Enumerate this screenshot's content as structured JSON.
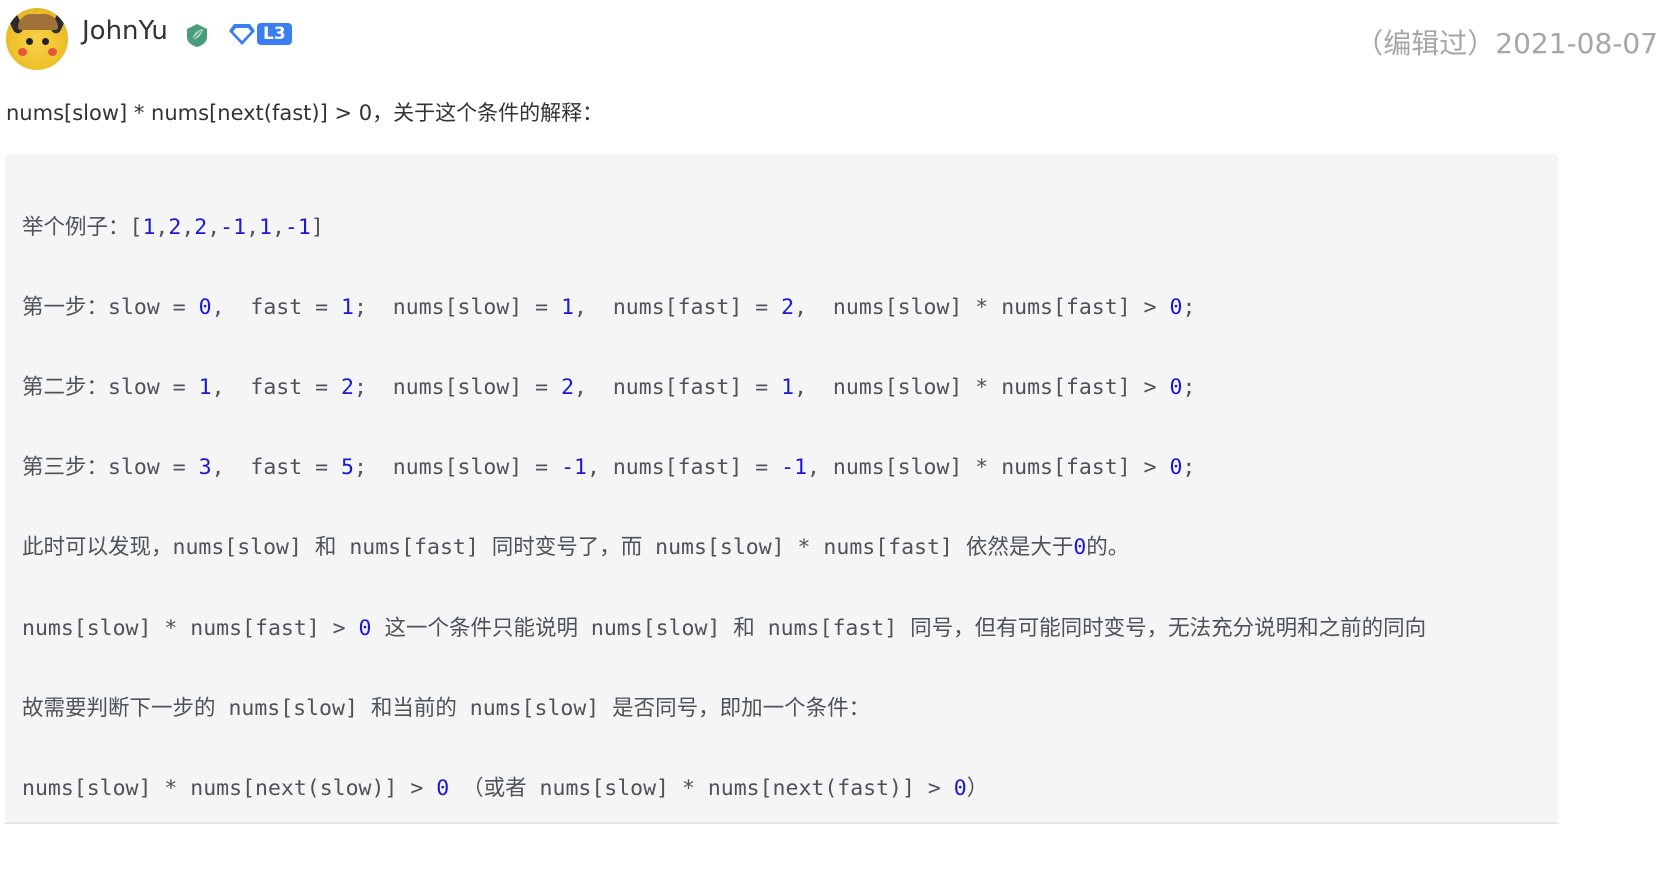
{
  "comment": {
    "author": "JohnYu",
    "level": "L3",
    "edited_label": "（编辑过）2021-08-07",
    "intro": "nums[slow] * nums[next(fast)] > 0，关于这个条件的解释："
  },
  "code_lines": [
    "举个例子：[1,2,2,-1,1,-1]",
    "第一步：slow = 0,  fast = 1;  nums[slow] = 1,  nums[fast] = 2,  nums[slow] * nums[fast] > 0;",
    "第二步：slow = 1,  fast = 2;  nums[slow] = 2,  nums[fast] = 1,  nums[slow] * nums[fast] > 0;",
    "第三步：slow = 3,  fast = 5;  nums[slow] = -1, nums[fast] = -1, nums[slow] * nums[fast] > 0;",
    "此时可以发现，nums[slow] 和 nums[fast] 同时变号了，而 nums[slow] * nums[fast] 依然是大于0的。",
    "nums[slow] * nums[fast] > 0 这一个条件只能说明 nums[slow] 和 nums[fast] 同号，但有可能同时变号，无法充分说明和之前的同向",
    "故需要判断下一步的 nums[slow] 和当前的 nums[slow] 是否同号，即加一个条件：",
    "nums[slow] * nums[next(slow)] > 0 （或者 nums[slow] * nums[next(fast)] > 0）"
  ],
  "icons": {
    "leaf": "leaf-badge-icon",
    "diamond": "diamond-icon"
  },
  "colors": {
    "level_badge": "#3a7ff1",
    "leaf_badge": "#4a9d7a",
    "code_bg": "#f5f5f5",
    "code_text": "#4e5259",
    "code_number": "#1818d6",
    "edited_text": "#a6a6a6"
  }
}
